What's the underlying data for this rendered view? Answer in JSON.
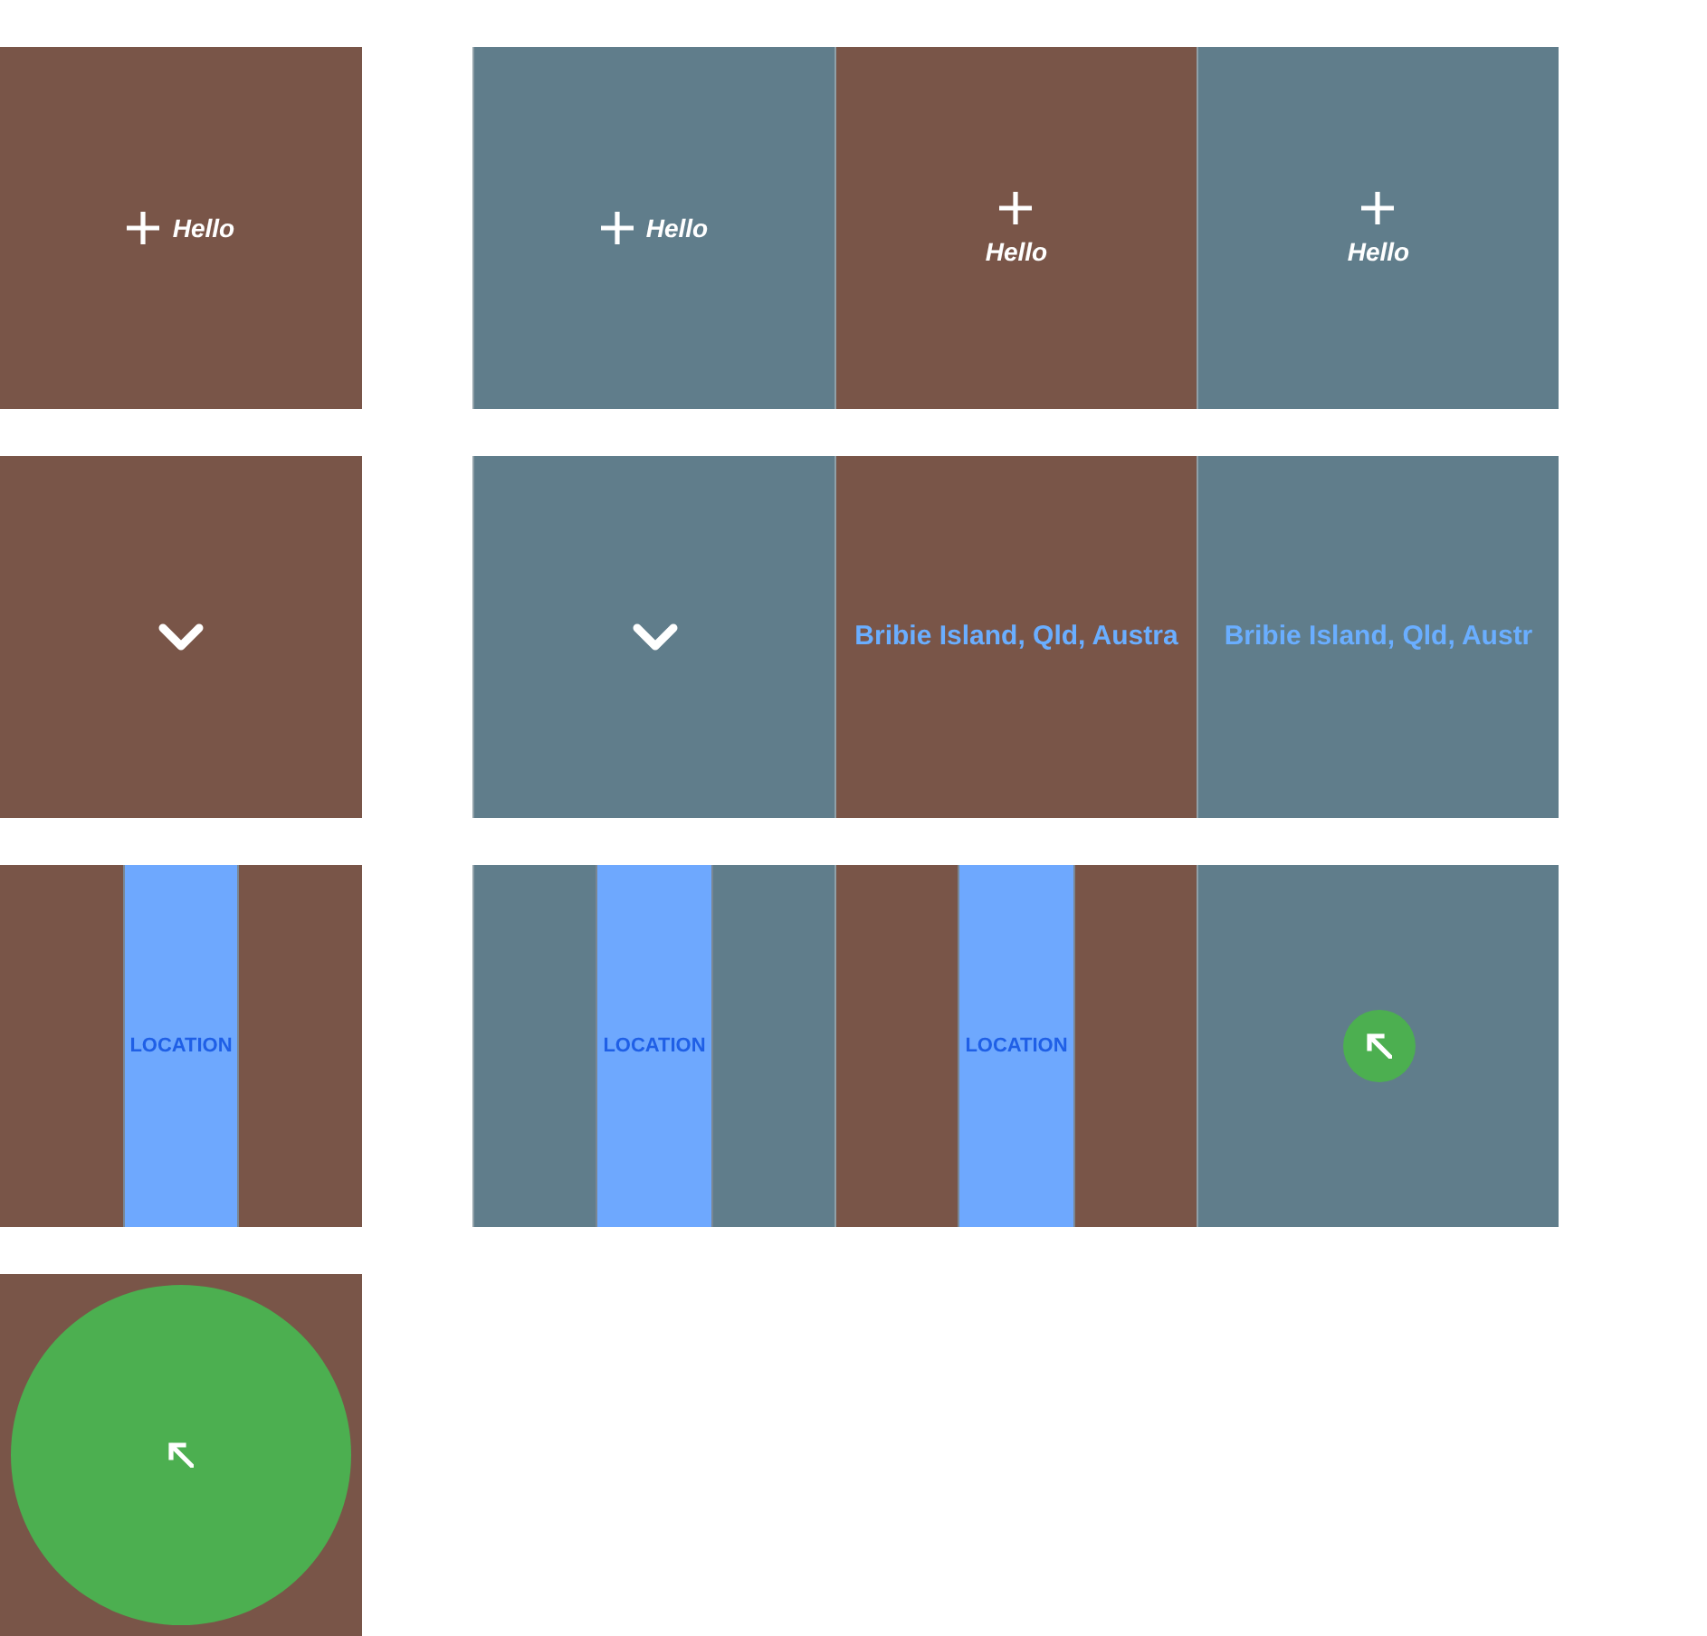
{
  "rows": [
    {
      "left": {
        "color": "#795548",
        "kind": "inline",
        "label": "Hello"
      },
      "group": [
        {
          "color": "#607d8b",
          "kind": "inline",
          "label": "Hello"
        },
        {
          "color": "#795548",
          "kind": "stacked",
          "label": "Hello"
        },
        {
          "color": "#607d8b",
          "kind": "stacked",
          "label": "Hello"
        }
      ]
    },
    {
      "left": {
        "color": "#795548",
        "kind": "chevron"
      },
      "group": [
        {
          "color": "#607d8b",
          "kind": "chevron"
        },
        {
          "color": "#795548",
          "kind": "place",
          "text": "Bribie Island, Qld, Austra"
        },
        {
          "color": "#607d8b",
          "kind": "place",
          "text": "Bribie Island, Qld, Austr"
        }
      ]
    },
    {
      "left": {
        "color": "#795548",
        "kind": "strip",
        "label": "LOCATION"
      },
      "group": [
        {
          "color": "#607d8b",
          "kind": "strip",
          "label": "LOCATION"
        },
        {
          "color": "#795548",
          "kind": "strip",
          "label": "LOCATION"
        },
        {
          "color": "#607d8b",
          "kind": "fab"
        }
      ]
    },
    {
      "left": {
        "color": "#795548",
        "kind": "disc"
      }
    }
  ]
}
